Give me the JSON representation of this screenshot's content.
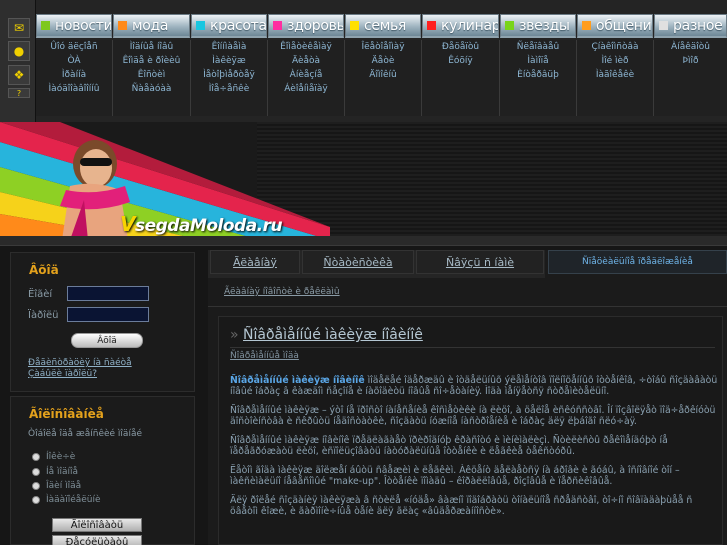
{
  "nav": {
    "tabs": [
      {
        "label": "новости",
        "color": "#7ec81e"
      },
      {
        "label": "мода",
        "color": "#ff8a1a"
      },
      {
        "label": "красота",
        "color": "#19c6e0"
      },
      {
        "label": "здоровье",
        "color": "#ff2ea0"
      },
      {
        "label": "семья",
        "color": "#ffe000"
      },
      {
        "label": "кулинария",
        "color": "#ff2020"
      },
      {
        "label": "звезды",
        "color": "#79d41a"
      },
      {
        "label": "общение",
        "color": "#ff9d1e"
      },
      {
        "label": "разное",
        "color": "#e0e0e0"
      }
    ],
    "sub": [
      [
        "Ûîó äëçîåñ",
        "ÒÀ",
        "Ìðàííà",
        "Ìàóäîîàâîîííû"
      ],
      [
        "Ìîäíûå íîâû",
        "Êîìäå è ðîèèû",
        "Êîñòèì",
        "Ñàåàóàà"
      ],
      [
        "Êîííìàåìà",
        "Ìàêèÿæ",
        "Ìåòîþìåðòåÿ",
        "Ìîå÷åñêè"
      ],
      [
        "Êîìåòèêåìàÿ",
        "Äèåòà",
        "Àíèåçíå",
        "Áèîåíìåïàÿ"
      ],
      [
        "Îëåòîåîìàÿ",
        "Äåòè",
        "Äîìîêíû",
        ""
      ],
      [
        "Ðåöåïòû",
        "Êóõíÿ",
        "",
        ""
      ],
      [
        "Ñëåïâàåû",
        "Ìàìîïå",
        "Èíòåðâüþ",
        ""
      ],
      [
        "Çíàêîìñòâà",
        "Ìîé ìèð",
        "Ìàãîêåêè",
        ""
      ],
      [
        "Àíåêäîòû",
        "Þìîð",
        "",
        ""
      ]
    ]
  },
  "banner": {
    "logo_v": "V",
    "logo_rest": "segdaMoloda.ru"
  },
  "login": {
    "title": "Âõîä",
    "login_label": "Ëîãèí",
    "password_label": "Ïàðîëü",
    "enter_label": "Âõîä",
    "register_link": "Ðåãèñòðàöèÿ íà ñàéòå",
    "forgot_link": "Çàáûëè ïàðîëü?"
  },
  "poll": {
    "title": "Ãîëîñîâàíèå",
    "question": "Òîáîëå îäå æåíñêèé ìîäíåé",
    "options": [
      "Íîêè÷è",
      "Íå ìîäíîå",
      "Îäèí ìîäå",
      "Ìàäàïîéåëüíè"
    ],
    "vote_label": "Ãîëîñîâàòü",
    "results_label": "Ðåçóëüòàòû"
  },
  "main": {
    "tabs": [
      "Ãëàâíàÿ",
      "Ñòàòèñòèêà",
      "Ñâÿçü ñ íàìè"
    ],
    "specials": "Ñïåöèàëüíîå ïðåäëîæåíèå",
    "breadcrumb": "Ãëàâíàÿ íîâîñòè è ðåêëàìû",
    "article_title": "Ñîâðåìåííûé ìàêèÿæ íîâèíîê",
    "article_sub": "Ñîâðåìåííûå ìîäà",
    "lead_bold": "Ñîâðåìåííûé ìàêèÿæ íîâèíîê",
    "p1": " ìîäåëåé îäåðæäû è îòäåëüíûõ ýëåìåíòîâ ïîëíîöåííûõ îòòåíêîâ, ÷òîáû ñîçäàâàòü íîâûé îáðàç â êàæäîì ñåçîíå è íàõîäèòü íîâûå ñî÷åòàíèÿ. Ìîäà ìåíÿåòñÿ ñòðåìèòåëüíî.",
    "p2": "Ñîâðåìåííûé ìàêèÿæ – ýòî íå ïðîñòî íàíåñåíèå êîñìåòèêè íà ëèöî, à öåëîå èñêóññòâî. Îí ïîçâîëÿåò ïîä÷åðêíóòü äîñòîèíñòâà è ñêðûòü íåäîñòàòêè, ñîçäàòü íóæíîå íàñòðîåíèå è îáðàç äëÿ ëþáîãî ñëó÷àÿ.",
    "p3": "Ñîâðåìåííûé ìàêèÿæ íîâèíîê ïðåäëàãàåò ïðèðîäíóþ êðàñîòó è ìèíèìàëèçì. Ñòèëèñòû ðåêîìåíäóþò íå ïåðåãðóæàòü ëèöî, èñïîëüçîâàòü íàòóðàëüíûå îòòåíêè è ëåãêèå òåêñòóðû.",
    "p4": "Ëåòîì ãîäà ìàêèÿæ äîëæåí áûòü ñâåæèì è ëåãêèì. Àêöåíò äåëàåòñÿ íà áðîâè è ãóáû, à îñíîâíîé òîí – ìàêñèìàëüíî íåâåñîìûé \"make-up\". Îòòåíêè ïîìàäû – êîðàëëîâûå, ðîçîâûå è ïåðñèêîâûå.",
    "p5": "Äëÿ ðîëåé ñîçäàíèÿ ìàêèÿæà â ñòèëå «íóäå» âàæíî ïîäîáðàòü òîíàëüíîå ñðåäñòâî, òî÷íî ñîâïàäàþùåå ñ öâåòîì êîæè, è ãàðìîíè÷íûå òåíè äëÿ ãëàç «âûäåðæàííîñòè»."
  }
}
